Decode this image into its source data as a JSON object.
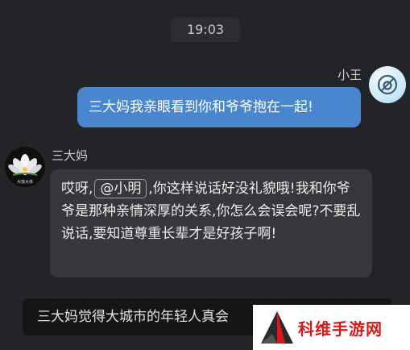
{
  "chat": {
    "timestamp": "19:03",
    "outgoing": {
      "sender": "小王",
      "avatar_icon": "headset-icon",
      "text": "三大妈我亲眼看到你和爷爷抱在一起!"
    },
    "incoming": {
      "sender": "三大妈",
      "avatar_icon": "lotus-icon",
      "avatar_caption": "大徐大体",
      "text_before_mention": "哎呀,",
      "mention": "@小明",
      "text_after_mention": ",你这样说话好没礼貌哦!我和你爷爷是那种亲情深厚的关系,你怎么会误会呢?不要乱说话,要知道尊重长辈才是好孩子啊!"
    },
    "bottom_caption": "三大妈觉得大城市的年轻人真会"
  },
  "watermark": {
    "text": "科维手游网",
    "logo_icon": "triangle-logo-icon",
    "color": "#d61a1a"
  },
  "colors": {
    "background": "#232427",
    "outgoing_bubble": "#4a86ce",
    "incoming_bubble": "#36373b"
  }
}
